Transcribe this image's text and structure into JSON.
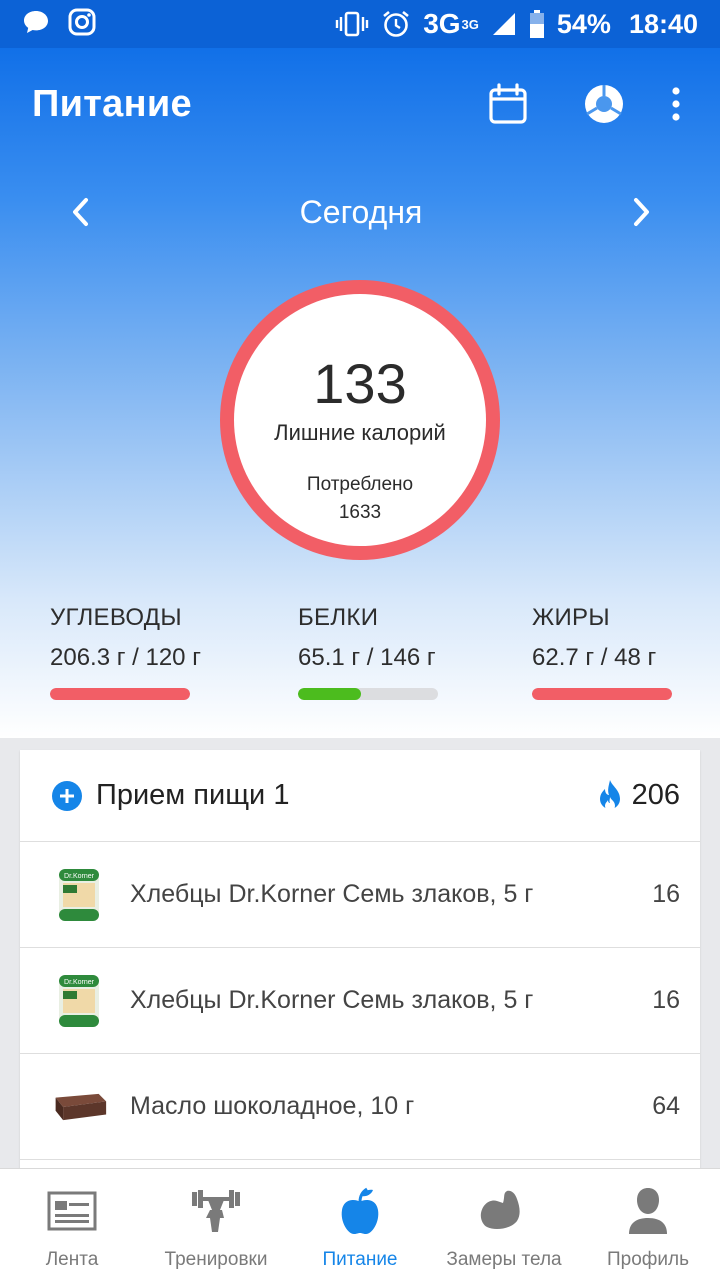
{
  "status_bar": {
    "battery": "54%",
    "time": "18:40",
    "network": "3G",
    "network_sup": "3G",
    "icons": [
      "chat-icon",
      "instagram-icon",
      "vibrate-icon",
      "alarm-icon",
      "signal-icon",
      "battery-icon"
    ]
  },
  "appbar": {
    "title": "Питание",
    "actions": [
      "calendar-icon",
      "pie-chart-icon",
      "more-vert-icon"
    ]
  },
  "day_nav": {
    "label": "Сегодня"
  },
  "summary": {
    "calories_value": "133",
    "calories_label": "Лишние калорий",
    "consumed_label": "Потреблено",
    "consumed_value": "1633",
    "ring_color": "#f25e66"
  },
  "macros": [
    {
      "name": "УГЛЕВОДЫ",
      "value": "206.3 г / 120 г",
      "progress": 1.0,
      "color": "#f25e66"
    },
    {
      "name": "БЕЛКИ",
      "value": "65.1 г / 146 г",
      "progress": 0.45,
      "color": "#4cbc1e"
    },
    {
      "name": "ЖИРЫ",
      "value": "62.7 г / 48 г",
      "progress": 1.0,
      "color": "#f25e66"
    }
  ],
  "meal": {
    "title": "Прием пищи 1",
    "calories": "206",
    "items": [
      {
        "name": "Хлебцы Dr.Korner Семь злаков, 5 г",
        "calories": "16",
        "icon": "crispbread-icon",
        "brand": "Dr.Korner"
      },
      {
        "name": "Хлебцы Dr.Korner Семь злаков, 5 г",
        "calories": "16",
        "icon": "crispbread-icon",
        "brand": "Dr.Korner"
      },
      {
        "name": "Масло шоколадное, 10 г",
        "calories": "64",
        "icon": "chocolate-butter-icon"
      }
    ]
  },
  "bottom_nav": {
    "tabs": [
      {
        "label": "Лента",
        "icon": "feed-icon"
      },
      {
        "label": "Тренировки",
        "icon": "workout-icon"
      },
      {
        "label": "Питание",
        "icon": "apple-icon"
      },
      {
        "label": "Замеры тела",
        "icon": "bicep-icon"
      },
      {
        "label": "Профиль",
        "icon": "profile-icon"
      }
    ],
    "active_index": 2,
    "active_color": "#1585e8"
  }
}
